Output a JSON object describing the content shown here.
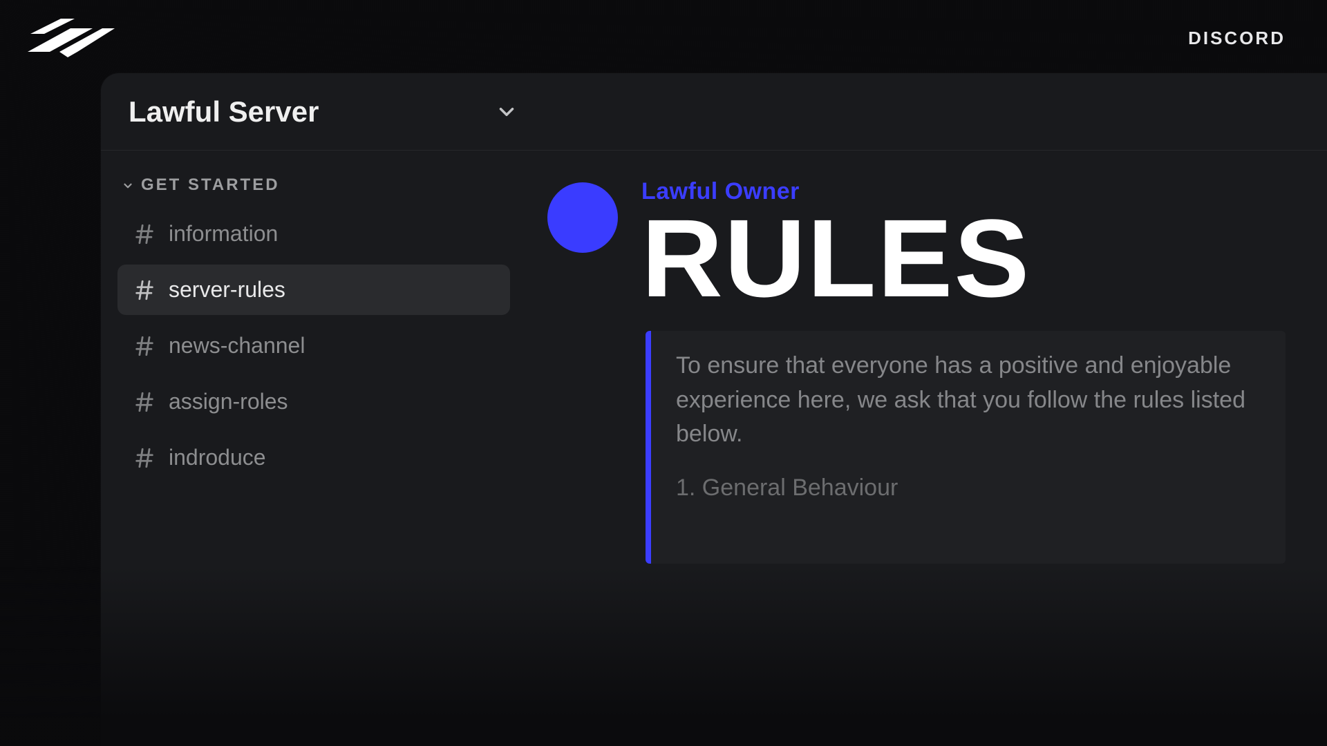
{
  "branding": {
    "right_label": "DISCORD"
  },
  "server": {
    "name": "Lawful Server"
  },
  "sidebar": {
    "category_label": "GET STARTED",
    "channels": [
      {
        "name": "information",
        "active": false
      },
      {
        "name": "server-rules",
        "active": true
      },
      {
        "name": "news-channel",
        "active": false
      },
      {
        "name": "assign-roles",
        "active": false
      },
      {
        "name": "indroduce",
        "active": false
      }
    ]
  },
  "message": {
    "author": "Lawful Owner",
    "title": "RULES",
    "accent_color": "#3b3dff",
    "embed": {
      "intro": "To ensure that everyone has a positive and enjoyable experience here, we ask that you follow the rules listed below.",
      "section_1": "1. General Behaviour"
    }
  }
}
